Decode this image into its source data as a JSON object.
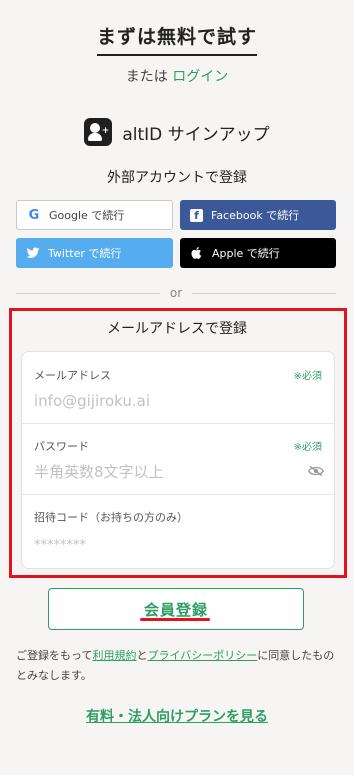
{
  "header": {
    "title": "まずは無料で試す",
    "or_text": "または",
    "login_link": "ログイン"
  },
  "altid": {
    "label": "altID サインアップ"
  },
  "external": {
    "title": "外部アカウントで登録",
    "google": "Google で続行",
    "facebook": "Facebook で続行",
    "twitter": "Twitter で続行",
    "apple": "Apple で続行"
  },
  "divider": "or",
  "email_form": {
    "title": "メールアドレスで登録",
    "email_label": "メールアドレス",
    "email_required": "※必須",
    "email_placeholder": "info@gijiroku.ai",
    "password_label": "パスワード",
    "password_required": "※必須",
    "password_placeholder": "半角英数8文字以上",
    "invite_label": "招待コード（お持ちの方のみ）",
    "invite_placeholder": "********"
  },
  "submit_label": "会員登録",
  "terms": {
    "prefix": "ご登録をもって",
    "terms_link": "利用規約",
    "middle": "と",
    "privacy_link": "プライバシーポリシー",
    "suffix": "に同意したものとみなします。"
  },
  "plan_link": "有料・法人向けプランを見る",
  "colors": {
    "accent": "#2e9e66",
    "highlight": "#e0141e",
    "facebook": "#3b5998",
    "twitter": "#55acee",
    "apple": "#000000",
    "background": "#f6f5f3"
  }
}
